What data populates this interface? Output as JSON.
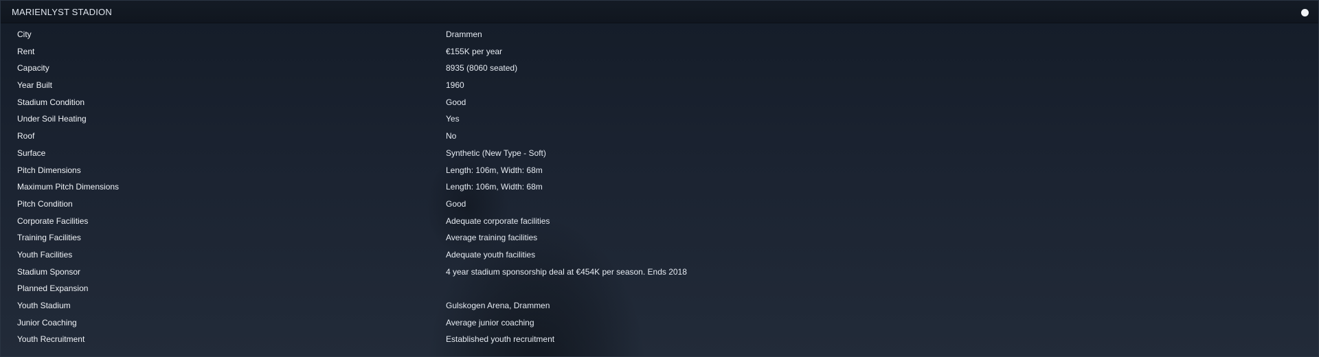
{
  "panel": {
    "title": "MARIENLYST STADION"
  },
  "rows": [
    {
      "label": "City",
      "value": "Drammen"
    },
    {
      "label": "Rent",
      "value": "€155K per year"
    },
    {
      "label": "Capacity",
      "value": "8935 (8060 seated)"
    },
    {
      "label": "Year Built",
      "value": "1960"
    },
    {
      "label": "Stadium Condition",
      "value": "Good"
    },
    {
      "label": "Under Soil Heating",
      "value": "Yes"
    },
    {
      "label": "Roof",
      "value": "No"
    },
    {
      "label": "Surface",
      "value": "Synthetic (New Type - Soft)"
    },
    {
      "label": "Pitch Dimensions",
      "value": "Length: 106m, Width: 68m"
    },
    {
      "label": "Maximum Pitch Dimensions",
      "value": "Length: 106m, Width: 68m"
    },
    {
      "label": "Pitch Condition",
      "value": "Good"
    },
    {
      "label": "Corporate Facilities",
      "value": "Adequate corporate facilities"
    },
    {
      "label": "Training Facilities",
      "value": "Average training facilities"
    },
    {
      "label": "Youth Facilities",
      "value": "Adequate youth facilities"
    },
    {
      "label": "Stadium Sponsor",
      "value": "4 year stadium sponsorship deal at €454K per season. Ends 2018"
    },
    {
      "label": "Planned Expansion",
      "value": ""
    },
    {
      "label": "Youth Stadium",
      "value": "Gulskogen Arena, Drammen"
    },
    {
      "label": "Junior Coaching",
      "value": "Average junior coaching"
    },
    {
      "label": "Youth Recruitment",
      "value": "Established youth recruitment"
    }
  ]
}
